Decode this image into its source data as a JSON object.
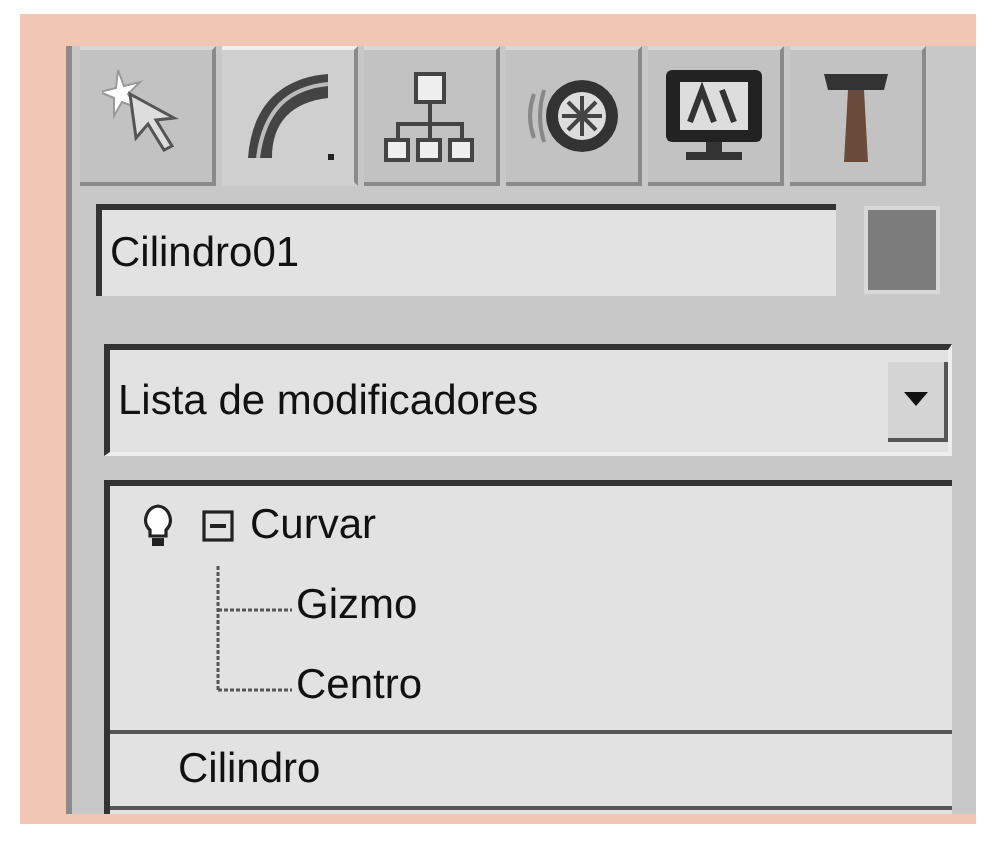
{
  "tabs": [
    {
      "kind": "create",
      "selected": false
    },
    {
      "kind": "modify",
      "selected": true
    },
    {
      "kind": "hierarchy",
      "selected": false
    },
    {
      "kind": "motion",
      "selected": false
    },
    {
      "kind": "display",
      "selected": false
    },
    {
      "kind": "utilities",
      "selected": false
    }
  ],
  "name_field": {
    "value": "Cilindro01"
  },
  "modifier_list": {
    "value": "Lista de modificadores"
  },
  "stack": [
    {
      "kind": "modifier",
      "label": "Curvar",
      "expanded": true,
      "children": [
        {
          "label": "Gizmo"
        },
        {
          "label": "Centro"
        }
      ]
    },
    {
      "kind": "base",
      "label": "Cilindro"
    }
  ]
}
